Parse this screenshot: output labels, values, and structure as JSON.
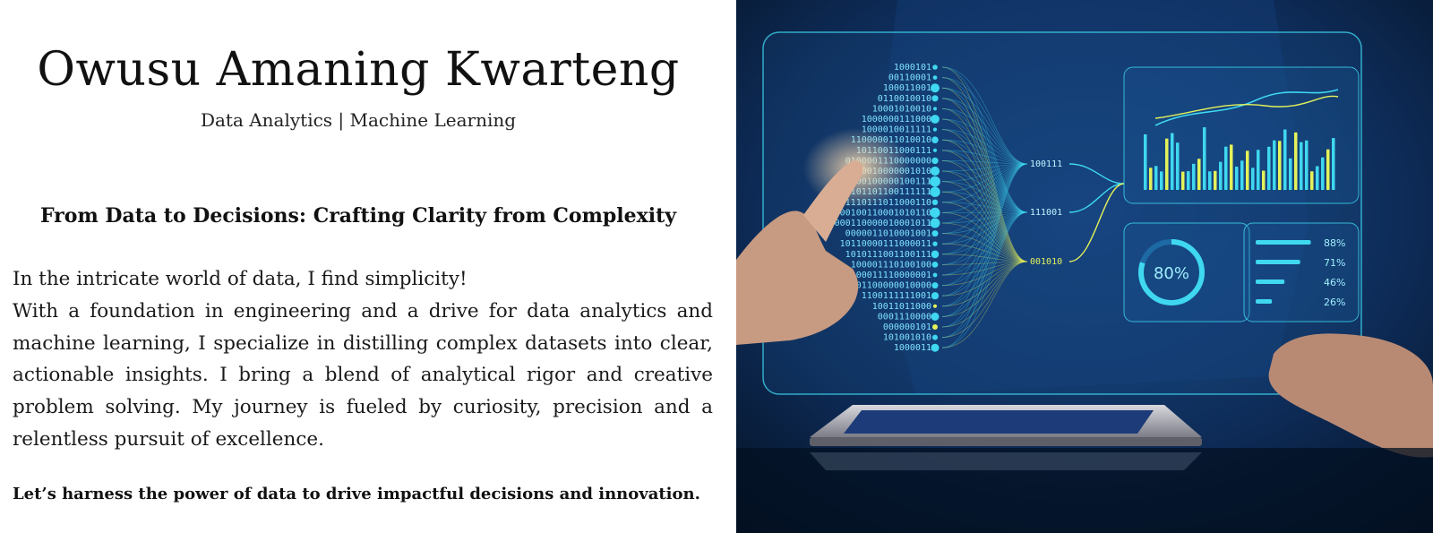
{
  "header": {
    "name": "Owusu Amaning Kwarteng",
    "subtitle": "Data Analytics | Machine Learning"
  },
  "main": {
    "headline": "From Data to Decisions: Crafting Clarity from Complexity",
    "intro": "In the intricate world of data, I find simplicity!",
    "paragraph": "With a foundation in engineering and a drive for data analytics and machine learning, I specialize in distilling complex datasets into clear, actionable insights. I bring a blend of analytical rigor and creative problem solving. My journey is fueled by curiosity, precision and a relentless pursuit of excellence.",
    "cta": "Let’s harness the power of data to drive impactful decisions and innovation."
  },
  "hero": {
    "gauge_label": "80%",
    "gauge_level": 0.8,
    "node_labels": [
      "100111",
      "111001",
      "001010"
    ],
    "bar_metrics": [
      {
        "label": "88%",
        "level": 0.88
      },
      {
        "label": "71%",
        "level": 0.71
      },
      {
        "label": "46%",
        "level": 0.46
      },
      {
        "label": "26%",
        "level": 0.26
      }
    ],
    "colors": {
      "background": "#0a1f3d",
      "hologram": "#3fd8f0",
      "accent": "#e4f25a"
    }
  }
}
